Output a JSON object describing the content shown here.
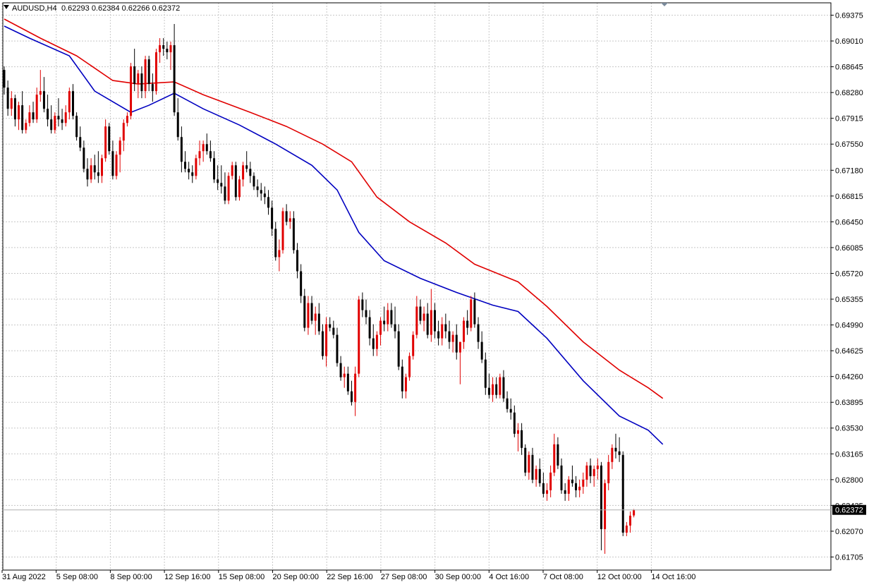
{
  "header": {
    "symbol_text": "AUDUSD,H4",
    "ohlc_text": "0.62293 0.62384 0.62266 0.62372"
  },
  "chart_data": {
    "type": "candlestick",
    "symbol": "AUDUSD",
    "timeframe": "H4",
    "current_price": "0.62372",
    "ylim": [
      0.6152,
      0.6955
    ],
    "y_ticks": [
      "0.69375",
      "0.69010",
      "0.68645",
      "0.68280",
      "0.67915",
      "0.67550",
      "0.67180",
      "0.66815",
      "0.66450",
      "0.66085",
      "0.65720",
      "0.65355",
      "0.64990",
      "0.64625",
      "0.64260",
      "0.63895",
      "0.63530",
      "0.63165",
      "0.62800",
      "0.62435",
      "0.62070",
      "0.61705"
    ],
    "x_ticks": [
      "31 Aug 2022",
      "5 Sep 08:00",
      "8 Sep 00:00",
      "12 Sep 16:00",
      "15 Sep 08:00",
      "20 Sep 00:00",
      "22 Sep 16:00",
      "27 Sep 08:00",
      "30 Sep 00:00",
      "4 Oct 16:00",
      "7 Oct 08:00",
      "12 Oct 00:00",
      "14 Oct 16:00"
    ],
    "grid": true,
    "colors": {
      "bull": "#e00000",
      "bear": "#000000",
      "ma_fast": "#0000c0",
      "ma_slow": "#e00000",
      "price_tag": "#000000"
    },
    "candles": [
      [
        0.686,
        0.6865,
        0.6825,
        0.6835
      ],
      [
        0.6835,
        0.6845,
        0.6795,
        0.6805
      ],
      [
        0.6805,
        0.683,
        0.6795,
        0.682
      ],
      [
        0.682,
        0.6825,
        0.678,
        0.679
      ],
      [
        0.679,
        0.6815,
        0.6775,
        0.681
      ],
      [
        0.681,
        0.683,
        0.677,
        0.6775
      ],
      [
        0.6775,
        0.679,
        0.677,
        0.6785
      ],
      [
        0.6785,
        0.681,
        0.678,
        0.68
      ],
      [
        0.68,
        0.6815,
        0.6785,
        0.679
      ],
      [
        0.679,
        0.6835,
        0.6785,
        0.6825
      ],
      [
        0.6825,
        0.686,
        0.6815,
        0.683
      ],
      [
        0.683,
        0.685,
        0.68,
        0.6805
      ],
      [
        0.6805,
        0.6825,
        0.678,
        0.679
      ],
      [
        0.679,
        0.681,
        0.677,
        0.6775
      ],
      [
        0.6775,
        0.68,
        0.677,
        0.6795
      ],
      [
        0.6795,
        0.682,
        0.678,
        0.679
      ],
      [
        0.679,
        0.6805,
        0.6775,
        0.6785
      ],
      [
        0.6785,
        0.681,
        0.678,
        0.68
      ],
      [
        0.68,
        0.6835,
        0.679,
        0.683
      ],
      [
        0.683,
        0.684,
        0.679,
        0.6795
      ],
      [
        0.6795,
        0.68,
        0.676,
        0.6765
      ],
      [
        0.6765,
        0.678,
        0.6745,
        0.675
      ],
      [
        0.675,
        0.676,
        0.6715,
        0.672
      ],
      [
        0.672,
        0.6735,
        0.6695,
        0.6705
      ],
      [
        0.6705,
        0.6735,
        0.67,
        0.6725
      ],
      [
        0.6725,
        0.674,
        0.6705,
        0.6715
      ],
      [
        0.6715,
        0.6745,
        0.67,
        0.671
      ],
      [
        0.671,
        0.674,
        0.67,
        0.6735
      ],
      [
        0.6735,
        0.679,
        0.673,
        0.678
      ],
      [
        0.678,
        0.6785,
        0.674,
        0.6745
      ],
      [
        0.6745,
        0.676,
        0.6705,
        0.671
      ],
      [
        0.671,
        0.6745,
        0.6705,
        0.674
      ],
      [
        0.674,
        0.6765,
        0.6715,
        0.676
      ],
      [
        0.676,
        0.679,
        0.6745,
        0.6785
      ],
      [
        0.6785,
        0.68,
        0.678,
        0.6795
      ],
      [
        0.6795,
        0.687,
        0.679,
        0.6865
      ],
      [
        0.6865,
        0.689,
        0.683,
        0.684
      ],
      [
        0.684,
        0.686,
        0.682,
        0.6855
      ],
      [
        0.6855,
        0.6865,
        0.682,
        0.683
      ],
      [
        0.683,
        0.688,
        0.682,
        0.6875
      ],
      [
        0.6875,
        0.688,
        0.683,
        0.684
      ],
      [
        0.684,
        0.6855,
        0.6815,
        0.683
      ],
      [
        0.683,
        0.689,
        0.6825,
        0.6885
      ],
      [
        0.6885,
        0.6905,
        0.687,
        0.6895
      ],
      [
        0.6895,
        0.6905,
        0.688,
        0.689
      ],
      [
        0.689,
        0.69,
        0.6875,
        0.6885
      ],
      [
        0.6885,
        0.69,
        0.686,
        0.6895
      ],
      [
        0.6895,
        0.6925,
        0.6795,
        0.68
      ],
      [
        0.68,
        0.682,
        0.676,
        0.6765
      ],
      [
        0.6765,
        0.678,
        0.6715,
        0.673
      ],
      [
        0.673,
        0.6745,
        0.6715,
        0.672
      ],
      [
        0.672,
        0.673,
        0.6705,
        0.6715
      ],
      [
        0.6715,
        0.6725,
        0.67,
        0.671
      ],
      [
        0.671,
        0.674,
        0.6705,
        0.6735
      ],
      [
        0.6735,
        0.676,
        0.6725,
        0.6745
      ],
      [
        0.6745,
        0.676,
        0.673,
        0.6755
      ],
      [
        0.6755,
        0.677,
        0.674,
        0.6745
      ],
      [
        0.6745,
        0.676,
        0.673,
        0.6735
      ],
      [
        0.6735,
        0.6745,
        0.67,
        0.6705
      ],
      [
        0.6705,
        0.6725,
        0.669,
        0.67
      ],
      [
        0.67,
        0.6725,
        0.6685,
        0.6695
      ],
      [
        0.6695,
        0.6715,
        0.667,
        0.6675
      ],
      [
        0.6675,
        0.6715,
        0.667,
        0.671
      ],
      [
        0.671,
        0.673,
        0.6705,
        0.6725
      ],
      [
        0.6725,
        0.673,
        0.6675,
        0.668
      ],
      [
        0.668,
        0.671,
        0.6675,
        0.6705
      ],
      [
        0.6705,
        0.673,
        0.6695,
        0.6725
      ],
      [
        0.6725,
        0.6745,
        0.6715,
        0.672
      ],
      [
        0.672,
        0.673,
        0.67,
        0.671
      ],
      [
        0.671,
        0.6715,
        0.669,
        0.6695
      ],
      [
        0.6695,
        0.6705,
        0.668,
        0.669
      ],
      [
        0.669,
        0.67,
        0.6675,
        0.6685
      ],
      [
        0.6685,
        0.6695,
        0.667,
        0.668
      ],
      [
        0.668,
        0.669,
        0.6655,
        0.6665
      ],
      [
        0.6665,
        0.6675,
        0.6625,
        0.6635
      ],
      [
        0.6635,
        0.6645,
        0.659,
        0.6595
      ],
      [
        0.6595,
        0.662,
        0.6575,
        0.6605
      ],
      [
        0.6605,
        0.6665,
        0.66,
        0.666
      ],
      [
        0.666,
        0.667,
        0.664,
        0.6645
      ],
      [
        0.6645,
        0.666,
        0.6635,
        0.665
      ],
      [
        0.665,
        0.666,
        0.66,
        0.6605
      ],
      [
        0.6605,
        0.6615,
        0.6565,
        0.6575
      ],
      [
        0.6575,
        0.6585,
        0.653,
        0.654
      ],
      [
        0.654,
        0.655,
        0.649,
        0.6495
      ],
      [
        0.6495,
        0.654,
        0.6485,
        0.653
      ],
      [
        0.653,
        0.654,
        0.65,
        0.6505
      ],
      [
        0.6505,
        0.6525,
        0.6485,
        0.6515
      ],
      [
        0.6515,
        0.653,
        0.6485,
        0.649
      ],
      [
        0.649,
        0.65,
        0.645,
        0.6455
      ],
      [
        0.6455,
        0.651,
        0.644,
        0.65
      ],
      [
        0.65,
        0.651,
        0.649,
        0.6495
      ],
      [
        0.6495,
        0.6505,
        0.648,
        0.6485
      ],
      [
        0.6485,
        0.6495,
        0.644,
        0.6445
      ],
      [
        0.6445,
        0.6455,
        0.642,
        0.6425
      ],
      [
        0.6425,
        0.644,
        0.641,
        0.643
      ],
      [
        0.643,
        0.644,
        0.64,
        0.6405
      ],
      [
        0.6405,
        0.642,
        0.6385,
        0.639
      ],
      [
        0.639,
        0.644,
        0.637,
        0.643
      ],
      [
        0.643,
        0.654,
        0.6425,
        0.6535
      ],
      [
        0.6535,
        0.6545,
        0.651,
        0.652
      ],
      [
        0.652,
        0.6535,
        0.65,
        0.651
      ],
      [
        0.651,
        0.652,
        0.647,
        0.648
      ],
      [
        0.648,
        0.65,
        0.6455,
        0.6465
      ],
      [
        0.6465,
        0.649,
        0.6455,
        0.6485
      ],
      [
        0.6485,
        0.651,
        0.647,
        0.6505
      ],
      [
        0.6505,
        0.6525,
        0.649,
        0.65
      ],
      [
        0.65,
        0.653,
        0.649,
        0.652
      ],
      [
        0.652,
        0.653,
        0.6495,
        0.65
      ],
      [
        0.65,
        0.6525,
        0.648,
        0.649
      ],
      [
        0.649,
        0.65,
        0.6435,
        0.644
      ],
      [
        0.644,
        0.645,
        0.6395,
        0.6405
      ],
      [
        0.6405,
        0.643,
        0.6395,
        0.6425
      ],
      [
        0.6425,
        0.646,
        0.642,
        0.6455
      ],
      [
        0.6455,
        0.649,
        0.645,
        0.6485
      ],
      [
        0.6485,
        0.654,
        0.648,
        0.6525
      ],
      [
        0.6525,
        0.6535,
        0.65,
        0.6505
      ],
      [
        0.6505,
        0.6525,
        0.649,
        0.6515
      ],
      [
        0.6515,
        0.653,
        0.648,
        0.6485
      ],
      [
        0.6485,
        0.655,
        0.6475,
        0.652
      ],
      [
        0.652,
        0.653,
        0.648,
        0.649
      ],
      [
        0.649,
        0.6505,
        0.647,
        0.648
      ],
      [
        0.648,
        0.651,
        0.647,
        0.65
      ],
      [
        0.65,
        0.6515,
        0.648,
        0.649
      ],
      [
        0.649,
        0.6505,
        0.6465,
        0.6475
      ],
      [
        0.6475,
        0.649,
        0.646,
        0.6485
      ],
      [
        0.6485,
        0.65,
        0.645,
        0.646
      ],
      [
        0.646,
        0.6475,
        0.6415,
        0.6475
      ],
      [
        0.6475,
        0.651,
        0.6465,
        0.6505
      ],
      [
        0.6505,
        0.652,
        0.6485,
        0.6495
      ],
      [
        0.6495,
        0.654,
        0.649,
        0.6535
      ],
      [
        0.6535,
        0.6545,
        0.6495,
        0.65
      ],
      [
        0.65,
        0.651,
        0.6465,
        0.6475
      ],
      [
        0.6475,
        0.649,
        0.6445,
        0.645
      ],
      [
        0.645,
        0.646,
        0.64,
        0.641
      ],
      [
        0.641,
        0.643,
        0.6395,
        0.64
      ],
      [
        0.64,
        0.6425,
        0.639,
        0.6415
      ],
      [
        0.6415,
        0.6425,
        0.6395,
        0.64
      ],
      [
        0.64,
        0.643,
        0.6395,
        0.6425
      ],
      [
        0.6425,
        0.6435,
        0.639,
        0.6395
      ],
      [
        0.6395,
        0.6405,
        0.6375,
        0.638
      ],
      [
        0.638,
        0.6395,
        0.6365,
        0.6375
      ],
      [
        0.6375,
        0.6385,
        0.634,
        0.6345
      ],
      [
        0.6345,
        0.636,
        0.632,
        0.635
      ],
      [
        0.635,
        0.636,
        0.6315,
        0.6325
      ],
      [
        0.6325,
        0.633,
        0.6285,
        0.629
      ],
      [
        0.629,
        0.632,
        0.628,
        0.6315
      ],
      [
        0.6315,
        0.6325,
        0.6275,
        0.628
      ],
      [
        0.628,
        0.63,
        0.627,
        0.6295
      ],
      [
        0.6295,
        0.631,
        0.627,
        0.6275
      ],
      [
        0.6275,
        0.629,
        0.6255,
        0.626
      ],
      [
        0.626,
        0.6275,
        0.625,
        0.6265
      ],
      [
        0.6265,
        0.63,
        0.6255,
        0.629
      ],
      [
        0.629,
        0.6345,
        0.6285,
        0.633
      ],
      [
        0.633,
        0.634,
        0.6295,
        0.63
      ],
      [
        0.63,
        0.631,
        0.626,
        0.6265
      ],
      [
        0.6265,
        0.6275,
        0.625,
        0.626
      ],
      [
        0.626,
        0.6285,
        0.625,
        0.628
      ],
      [
        0.628,
        0.63,
        0.627,
        0.6275
      ],
      [
        0.6275,
        0.6285,
        0.6255,
        0.6265
      ],
      [
        0.6265,
        0.628,
        0.6255,
        0.627
      ],
      [
        0.627,
        0.629,
        0.626,
        0.628
      ],
      [
        0.628,
        0.6305,
        0.627,
        0.63
      ],
      [
        0.63,
        0.631,
        0.6275,
        0.6285
      ],
      [
        0.6285,
        0.63,
        0.627,
        0.6295
      ],
      [
        0.6295,
        0.631,
        0.628,
        0.63
      ],
      [
        0.63,
        0.6305,
        0.618,
        0.621
      ],
      [
        0.621,
        0.628,
        0.6175,
        0.6275
      ],
      [
        0.6275,
        0.6315,
        0.6265,
        0.6305
      ],
      [
        0.6305,
        0.633,
        0.6295,
        0.6325
      ],
      [
        0.6325,
        0.6345,
        0.631,
        0.632
      ],
      [
        0.632,
        0.634,
        0.6305,
        0.6315
      ],
      [
        0.6315,
        0.632,
        0.62,
        0.6205
      ],
      [
        0.6205,
        0.622,
        0.62,
        0.6215
      ],
      [
        0.6215,
        0.6235,
        0.6205,
        0.6229
      ],
      [
        0.62293,
        0.62384,
        0.62266,
        0.62372
      ]
    ],
    "ma_fast_points": [
      [
        0,
        0.6922
      ],
      [
        7,
        0.6905
      ],
      [
        18,
        0.688
      ],
      [
        25,
        0.683
      ],
      [
        35,
        0.68
      ],
      [
        40,
        0.681
      ],
      [
        47,
        0.6827
      ],
      [
        55,
        0.6805
      ],
      [
        65,
        0.6782
      ],
      [
        75,
        0.6755
      ],
      [
        85,
        0.6725
      ],
      [
        92,
        0.669
      ],
      [
        98,
        0.663
      ],
      [
        105,
        0.659
      ],
      [
        115,
        0.6565
      ],
      [
        125,
        0.6545
      ],
      [
        135,
        0.6527
      ],
      [
        142,
        0.6518
      ],
      [
        150,
        0.648
      ],
      [
        160,
        0.642
      ],
      [
        170,
        0.637
      ],
      [
        178,
        0.635
      ],
      [
        182,
        0.633
      ]
    ],
    "ma_slow_points": [
      [
        0,
        0.6932
      ],
      [
        10,
        0.6905
      ],
      [
        20,
        0.688
      ],
      [
        30,
        0.6845
      ],
      [
        37,
        0.684
      ],
      [
        47,
        0.6843
      ],
      [
        55,
        0.6825
      ],
      [
        68,
        0.68
      ],
      [
        78,
        0.678
      ],
      [
        88,
        0.6755
      ],
      [
        96,
        0.673
      ],
      [
        103,
        0.668
      ],
      [
        112,
        0.6645
      ],
      [
        122,
        0.6615
      ],
      [
        130,
        0.6585
      ],
      [
        142,
        0.656
      ],
      [
        150,
        0.6525
      ],
      [
        160,
        0.6475
      ],
      [
        170,
        0.6435
      ],
      [
        178,
        0.641
      ],
      [
        182,
        0.6395
      ]
    ]
  }
}
